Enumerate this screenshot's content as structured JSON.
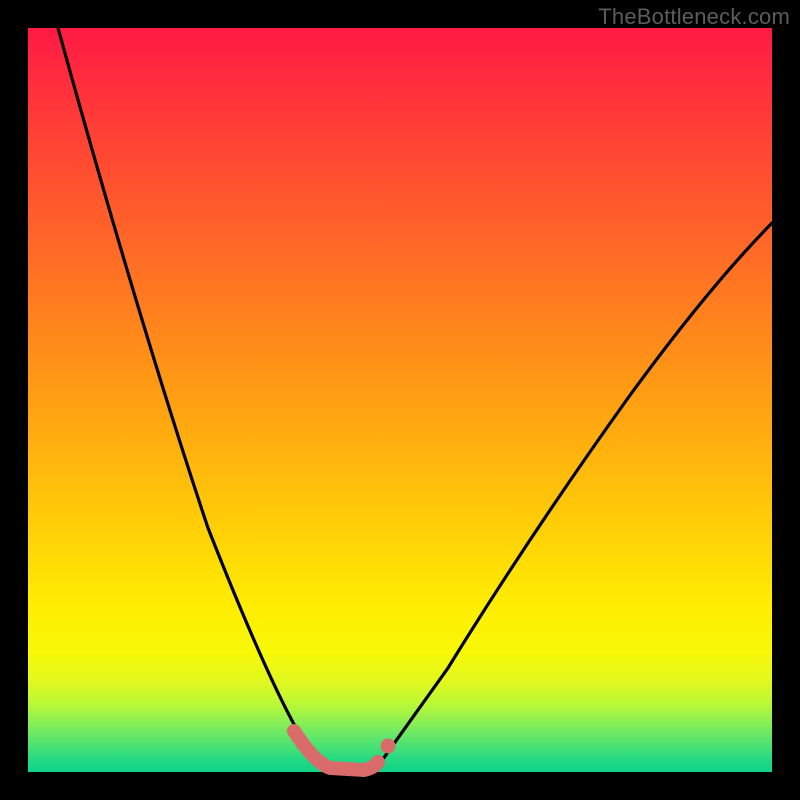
{
  "watermark": "TheBottleneck.com",
  "colors": {
    "frame": "#000000",
    "curve": "#000000",
    "accent": "#d96b6b",
    "gradient_top": "#ff1a44",
    "gradient_mid": "#ffee02",
    "gradient_bottom": "#10d488"
  },
  "chart_data": {
    "type": "line",
    "title": "",
    "xlabel": "",
    "ylabel": "",
    "xlim": [
      0,
      100
    ],
    "ylim": [
      0,
      100
    ],
    "grid": false,
    "legend": false,
    "series": [
      {
        "name": "bottleneck-curve",
        "x": [
          4,
          6,
          8,
          10,
          12,
          14,
          16,
          18,
          20,
          22,
          24,
          26,
          28,
          30,
          32,
          34,
          36,
          38,
          40,
          42,
          44,
          46,
          50,
          55,
          60,
          65,
          70,
          75,
          80,
          85,
          90,
          95,
          100
        ],
        "y": [
          100,
          93,
          86,
          79,
          72,
          65,
          58,
          51,
          45,
          39,
          33,
          28,
          23,
          18,
          13,
          9,
          5,
          2,
          0,
          0,
          0,
          2,
          6,
          12,
          19,
          27,
          35,
          43,
          51,
          58,
          64,
          70,
          74
        ]
      }
    ],
    "annotations": [
      {
        "name": "optimal-range-marker",
        "x_start": 36,
        "x_end": 47,
        "y": 1
      },
      {
        "name": "marker-dot",
        "x": 47.5,
        "y": 3
      }
    ]
  }
}
